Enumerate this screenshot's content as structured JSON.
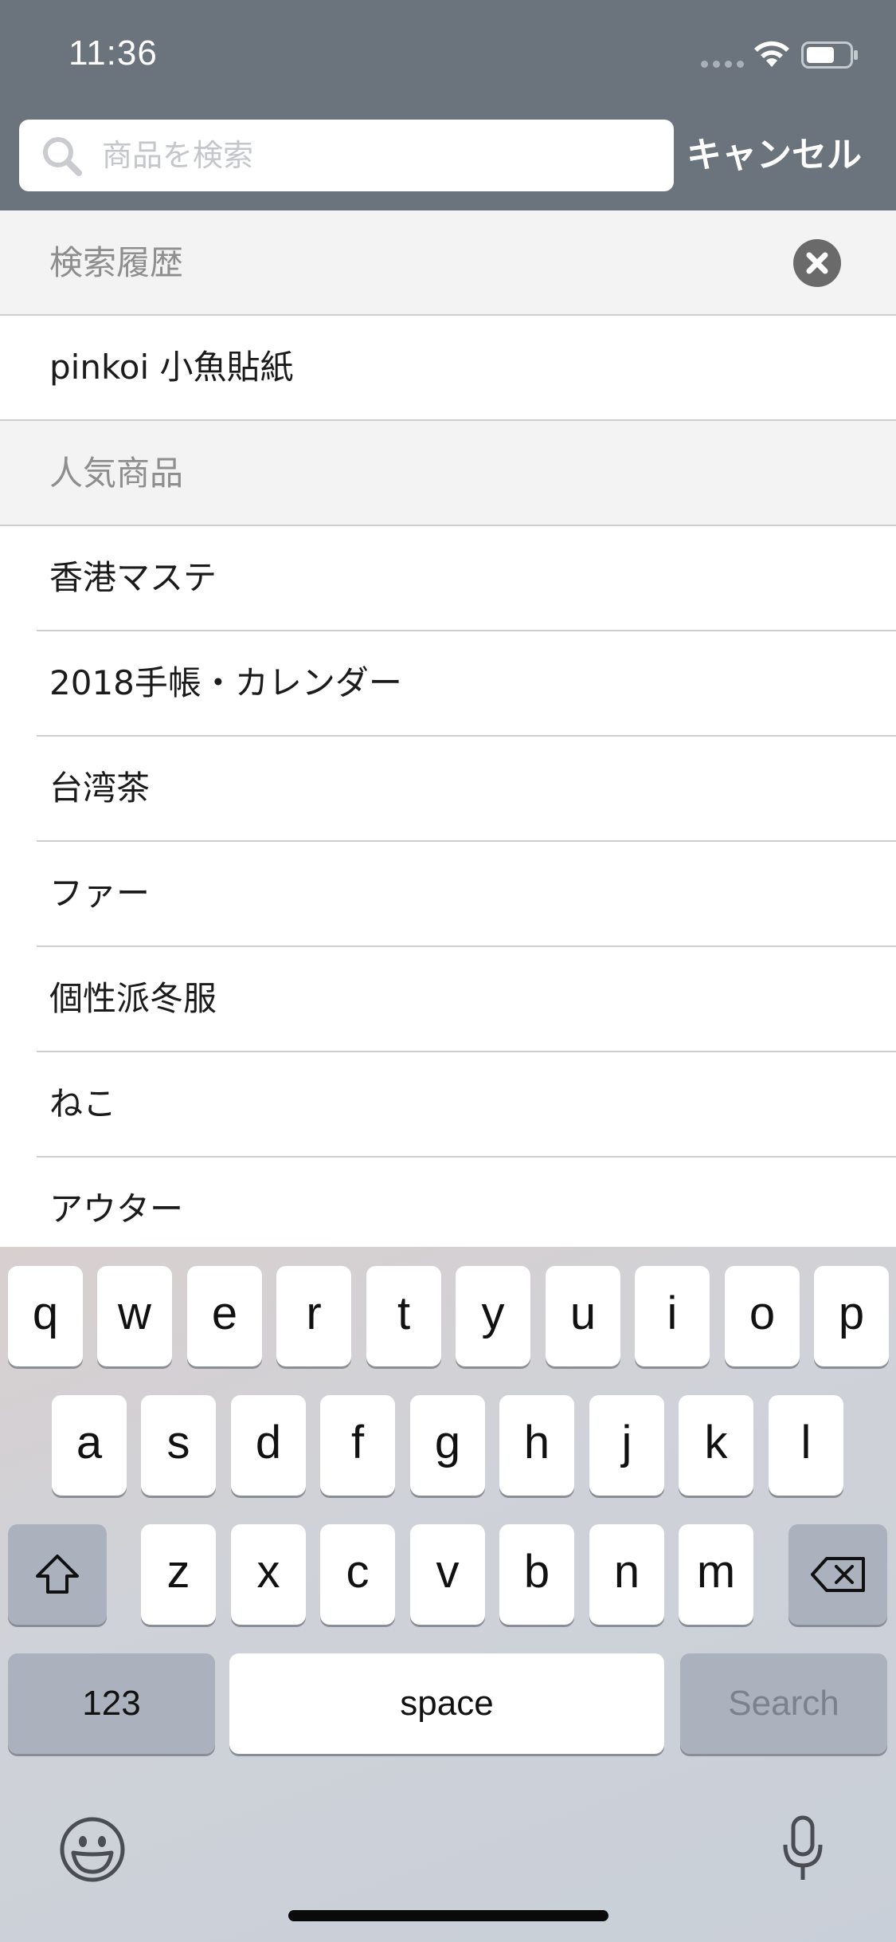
{
  "status_bar": {
    "time": "11:36"
  },
  "search": {
    "placeholder": "商品を検索",
    "value": "",
    "cancel_label": "キャンセル"
  },
  "history": {
    "title": "検索履歴",
    "items": [
      "pinkoi 小魚貼紙"
    ]
  },
  "popular": {
    "title": "人気商品",
    "items": [
      "香港マステ",
      "2018手帳・カレンダー",
      "台湾茶",
      "ファー",
      "個性派冬服",
      "ねこ",
      "アウター"
    ]
  },
  "keyboard": {
    "row1": [
      "q",
      "w",
      "e",
      "r",
      "t",
      "y",
      "u",
      "i",
      "o",
      "p"
    ],
    "row2": [
      "a",
      "s",
      "d",
      "f",
      "g",
      "h",
      "j",
      "k",
      "l"
    ],
    "row3": [
      "z",
      "x",
      "c",
      "v",
      "b",
      "n",
      "m"
    ],
    "numbers_label": "123",
    "space_label": "space",
    "search_label": "Search"
  },
  "colors": {
    "header_bg": "#6b737c",
    "section_bg": "#f3f3f3",
    "keyboard_bg": "#cfd2d8"
  }
}
